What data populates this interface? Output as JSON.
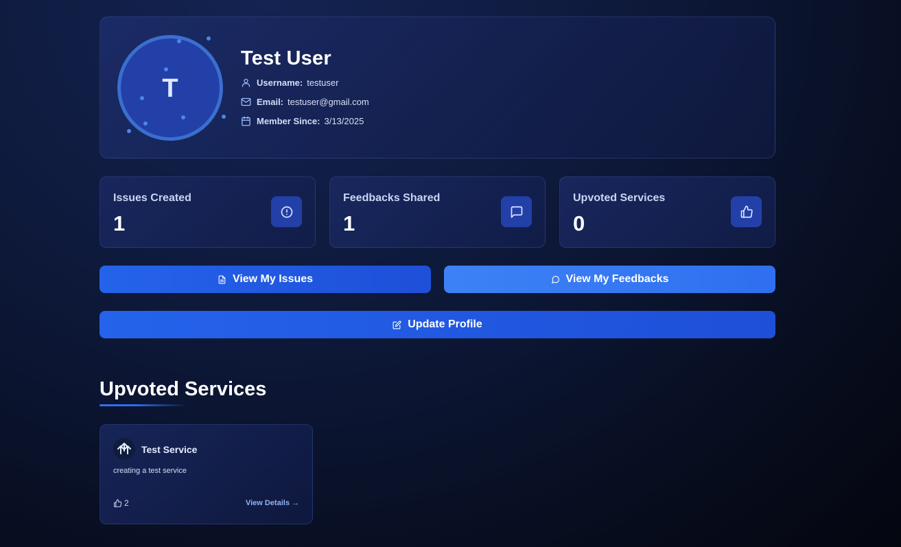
{
  "profile": {
    "avatar_letter": "T",
    "name": "Test User",
    "username_label": "Username:",
    "username": "testuser",
    "email_label": "Email:",
    "email": "testuser@gmail.com",
    "member_since_label": "Member Since:",
    "member_since": "3/13/2025"
  },
  "stats": [
    {
      "label": "Issues Created",
      "value": "1",
      "icon": "alert-circle-icon"
    },
    {
      "label": "Feedbacks Shared",
      "value": "1",
      "icon": "message-square-icon"
    },
    {
      "label": "Upvoted Services",
      "value": "0",
      "icon": "thumbs-up-icon"
    }
  ],
  "actions": {
    "view_issues": "View My Issues",
    "view_feedbacks": "View My Feedbacks",
    "update_profile": "Update Profile"
  },
  "upvoted_section": {
    "title": "Upvoted Services",
    "services": [
      {
        "name": "Test Service",
        "description": "creating a test service",
        "votes": "2",
        "link_label": "View Details →"
      }
    ]
  },
  "colors": {
    "accent": "#2563eb",
    "accent_light": "#3d82f5",
    "icon_bg": "#2340a8",
    "icon_stroke": "#9fc0ff"
  }
}
